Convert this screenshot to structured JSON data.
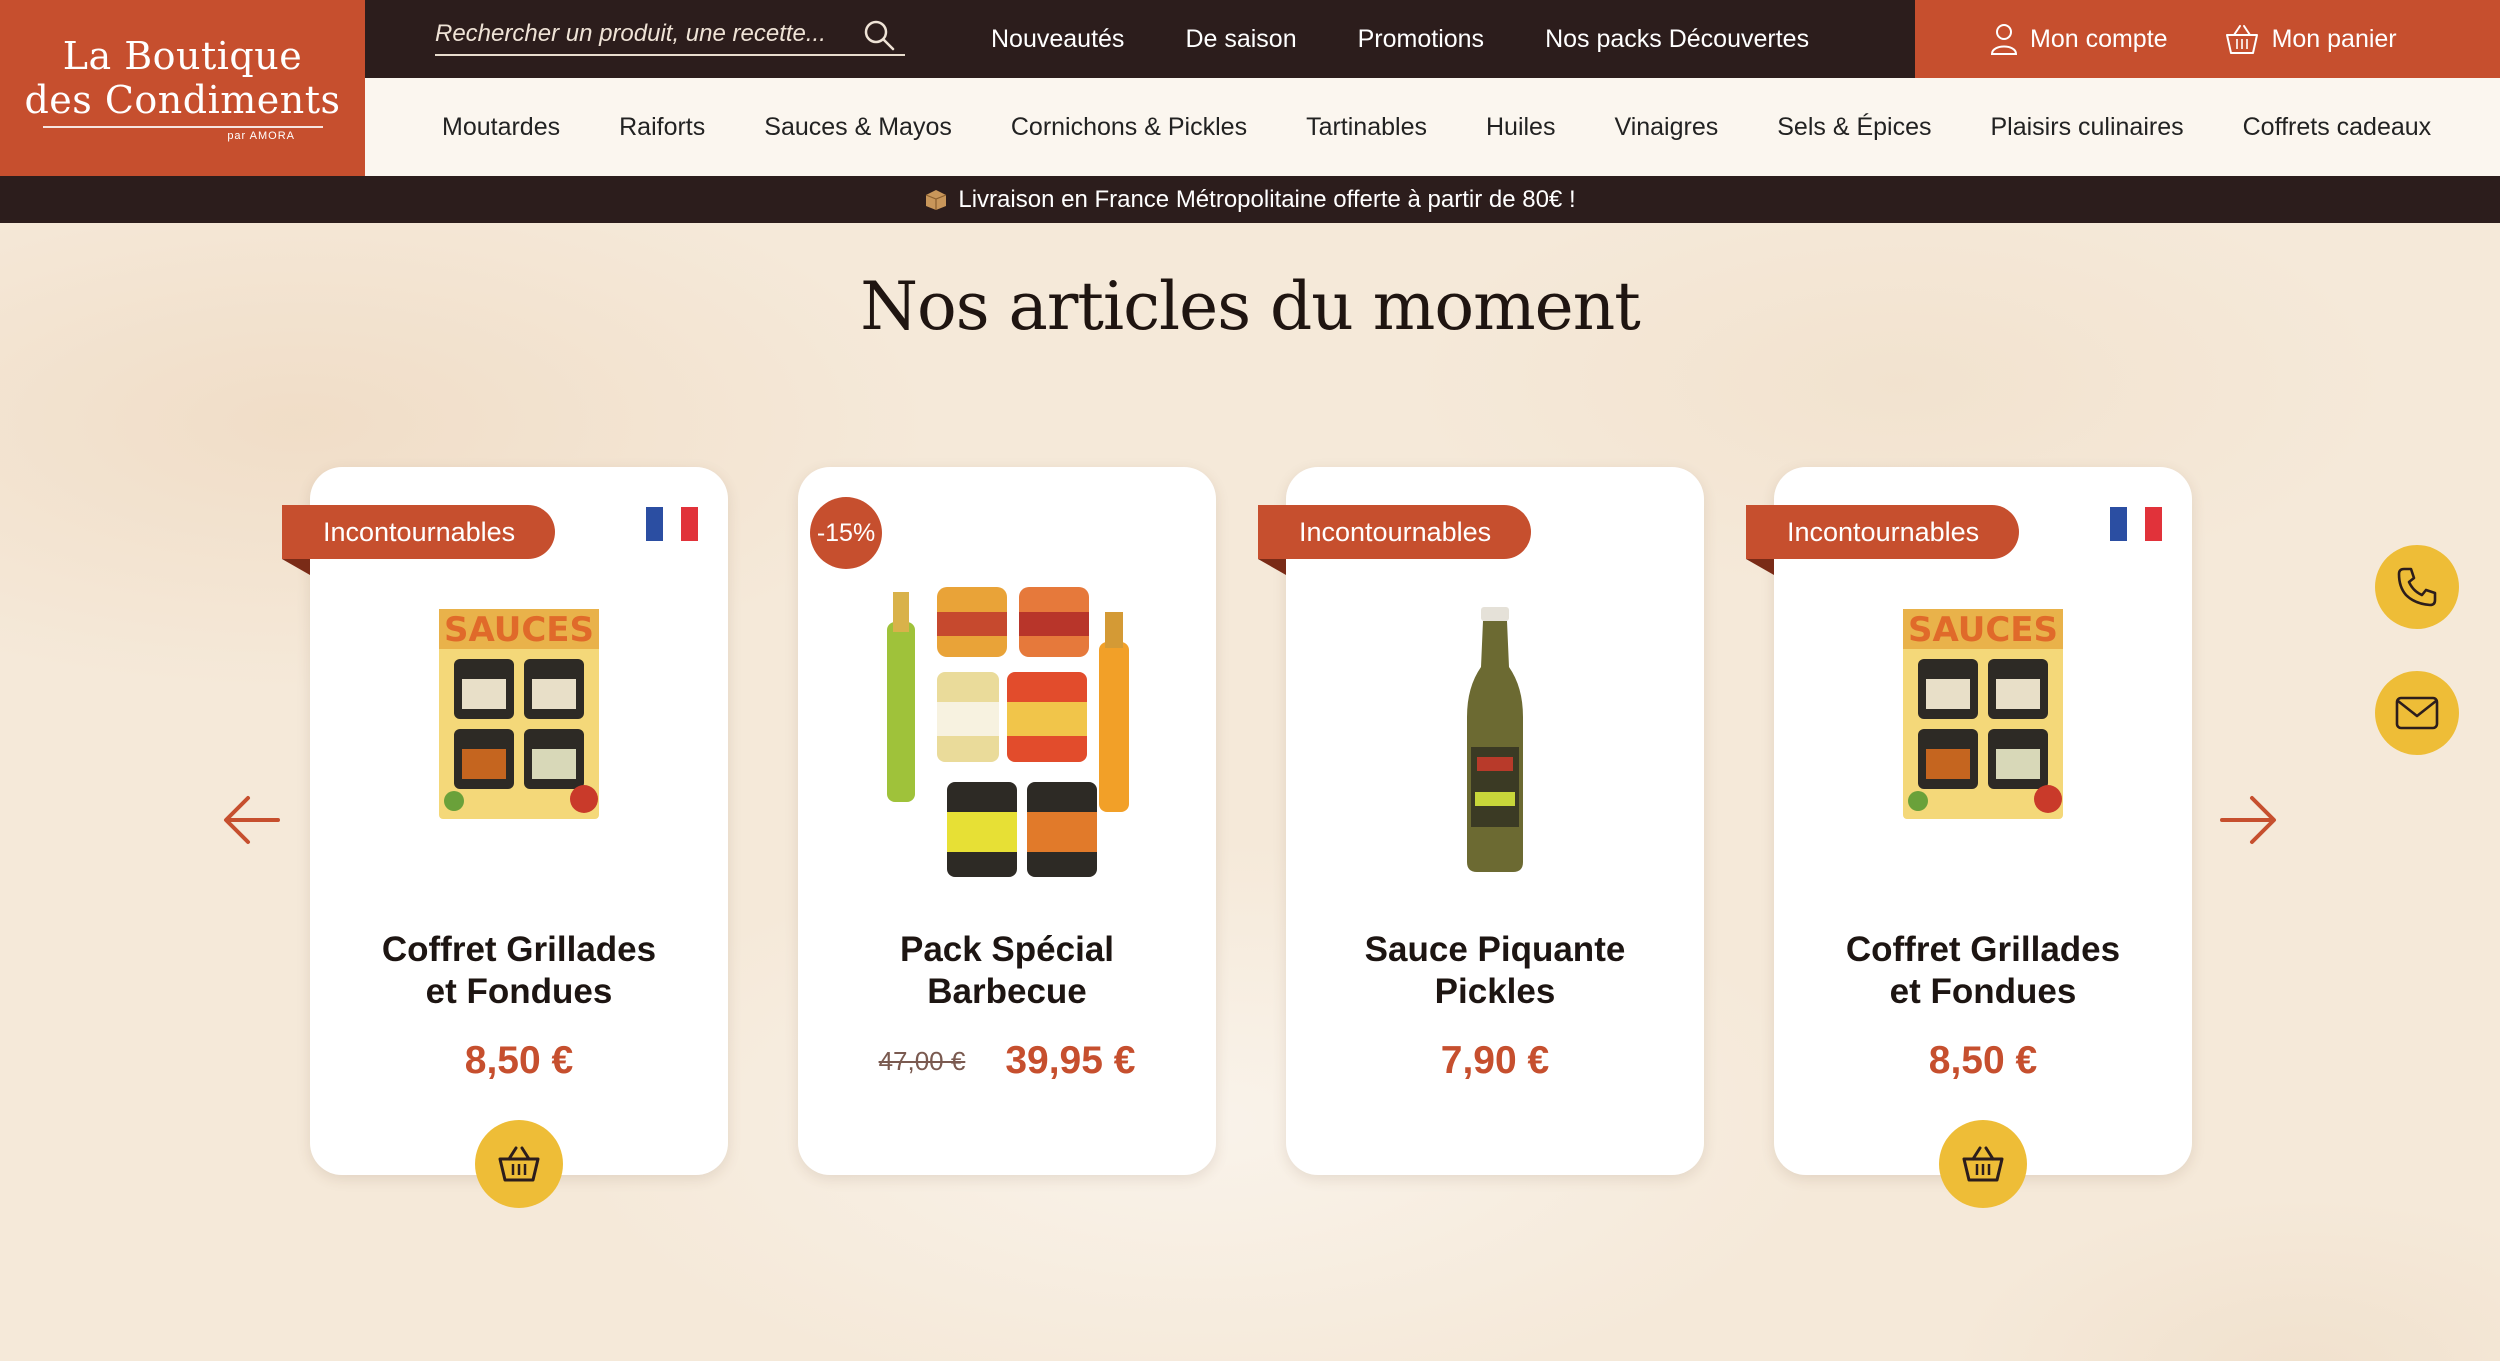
{
  "logo": {
    "line1": "La Boutique",
    "line2": "des Condiments",
    "byline": "par AMORA"
  },
  "search": {
    "placeholder": "Rechercher un produit, une recette..."
  },
  "top_nav": [
    "Nouveautés",
    "De saison",
    "Promotions",
    "Nos packs Découvertes"
  ],
  "account": {
    "my_account": "Mon compte",
    "my_cart": "Mon panier"
  },
  "main_nav": [
    "Moutardes",
    "Raiforts",
    "Sauces & Mayos",
    "Cornichons & Pickles",
    "Tartinables",
    "Huiles",
    "Vinaigres",
    "Sels & Épices",
    "Plaisirs culinaires",
    "Coffrets cadeaux"
  ],
  "banner": {
    "text": "Livraison en France Métropolitaine offerte à partir de 80€ !"
  },
  "section_title": "Nos articles du moment",
  "products": [
    {
      "badge": "Incontournables",
      "title_line1": "Coffret Grillades",
      "title_line2": "et Fondues",
      "price": "8,50 €",
      "flag": "france-flag",
      "cart": true
    },
    {
      "discount": "-15%",
      "title_line1": "Pack Spécial",
      "title_line2": "Barbecue",
      "old_price": "47,00 €",
      "price": "39,95 €",
      "cart": false
    },
    {
      "badge": "Incontournables",
      "title_line1": "Sauce Piquante",
      "title_line2": "Pickles",
      "price": "7,90 €",
      "cart": false
    },
    {
      "badge": "Incontournables",
      "title_line1": "Coffret Grillades",
      "title_line2": "et Fondues",
      "price": "8,50 €",
      "flag": "france-flag",
      "cart": true
    }
  ],
  "colors": {
    "brand_red": "#c64f2e",
    "dark_brown": "#2c1d1c",
    "yellow": "#eebd37",
    "cream": "#f6eadb"
  },
  "icons": [
    "search-icon",
    "user-icon",
    "basket-icon",
    "phone-icon",
    "mail-icon",
    "arrow-left-icon",
    "arrow-right-icon",
    "cart-icon",
    "package-icon"
  ]
}
